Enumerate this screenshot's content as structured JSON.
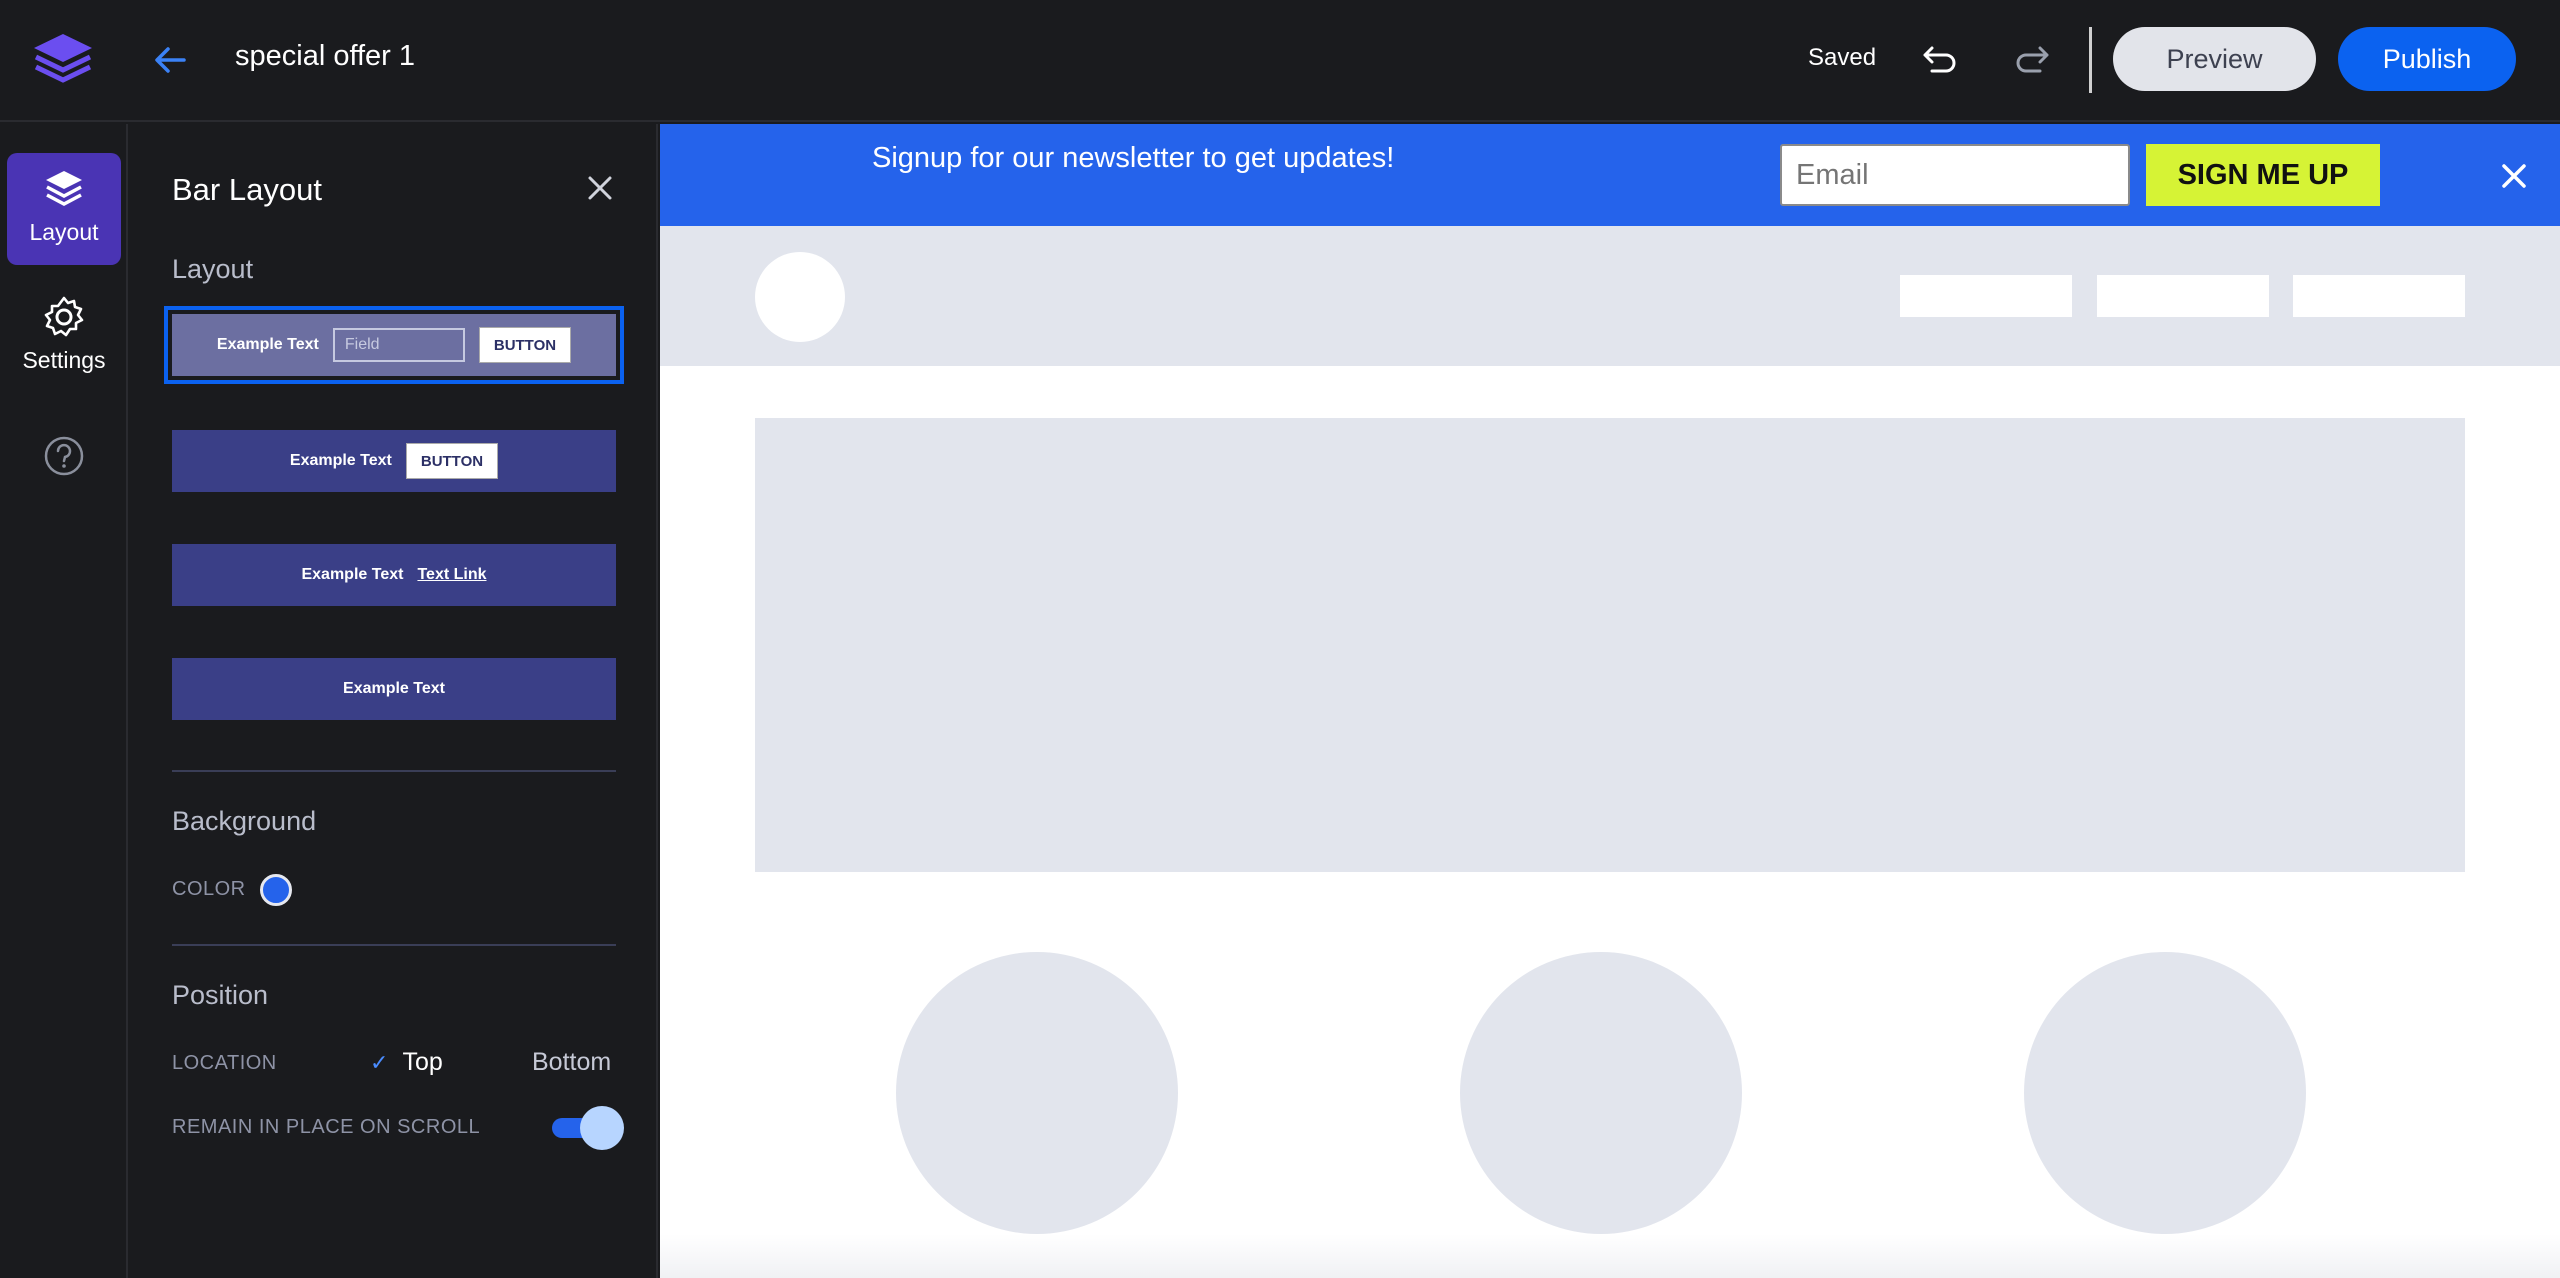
{
  "topbar": {
    "title": "special offer 1",
    "status": "Saved",
    "preview_label": "Preview",
    "publish_label": "Publish"
  },
  "rail": {
    "items": [
      {
        "label": "Layout",
        "icon": "layers-icon",
        "active": true
      },
      {
        "label": "Settings",
        "icon": "gear-icon",
        "active": false
      }
    ],
    "help_icon": "help-icon"
  },
  "panel": {
    "title": "Bar Layout",
    "layout_section": "Layout",
    "layout_options": [
      {
        "text": "Example Text",
        "field": "Field",
        "button": "BUTTON",
        "selected": true
      },
      {
        "text": "Example Text",
        "button": "BUTTON",
        "selected": false
      },
      {
        "text": "Example Text",
        "link": "Text Link",
        "selected": false
      },
      {
        "text": "Example Text",
        "selected": false
      }
    ],
    "background_section": "Background",
    "color_label": "COLOR",
    "color_value": "#2563eb",
    "position_section": "Position",
    "location_label": "LOCATION",
    "location_options": [
      "Top",
      "Bottom"
    ],
    "location_selected": "Top",
    "scroll_label": "REMAIN IN PLACE ON SCROLL",
    "scroll_enabled": true
  },
  "canvas": {
    "notice_text": "Signup for our newsletter to get updates!",
    "email_placeholder": "Email",
    "signup_label": "SIGN ME UP",
    "bar_color": "#2563eb",
    "button_color": "#d6f335"
  }
}
